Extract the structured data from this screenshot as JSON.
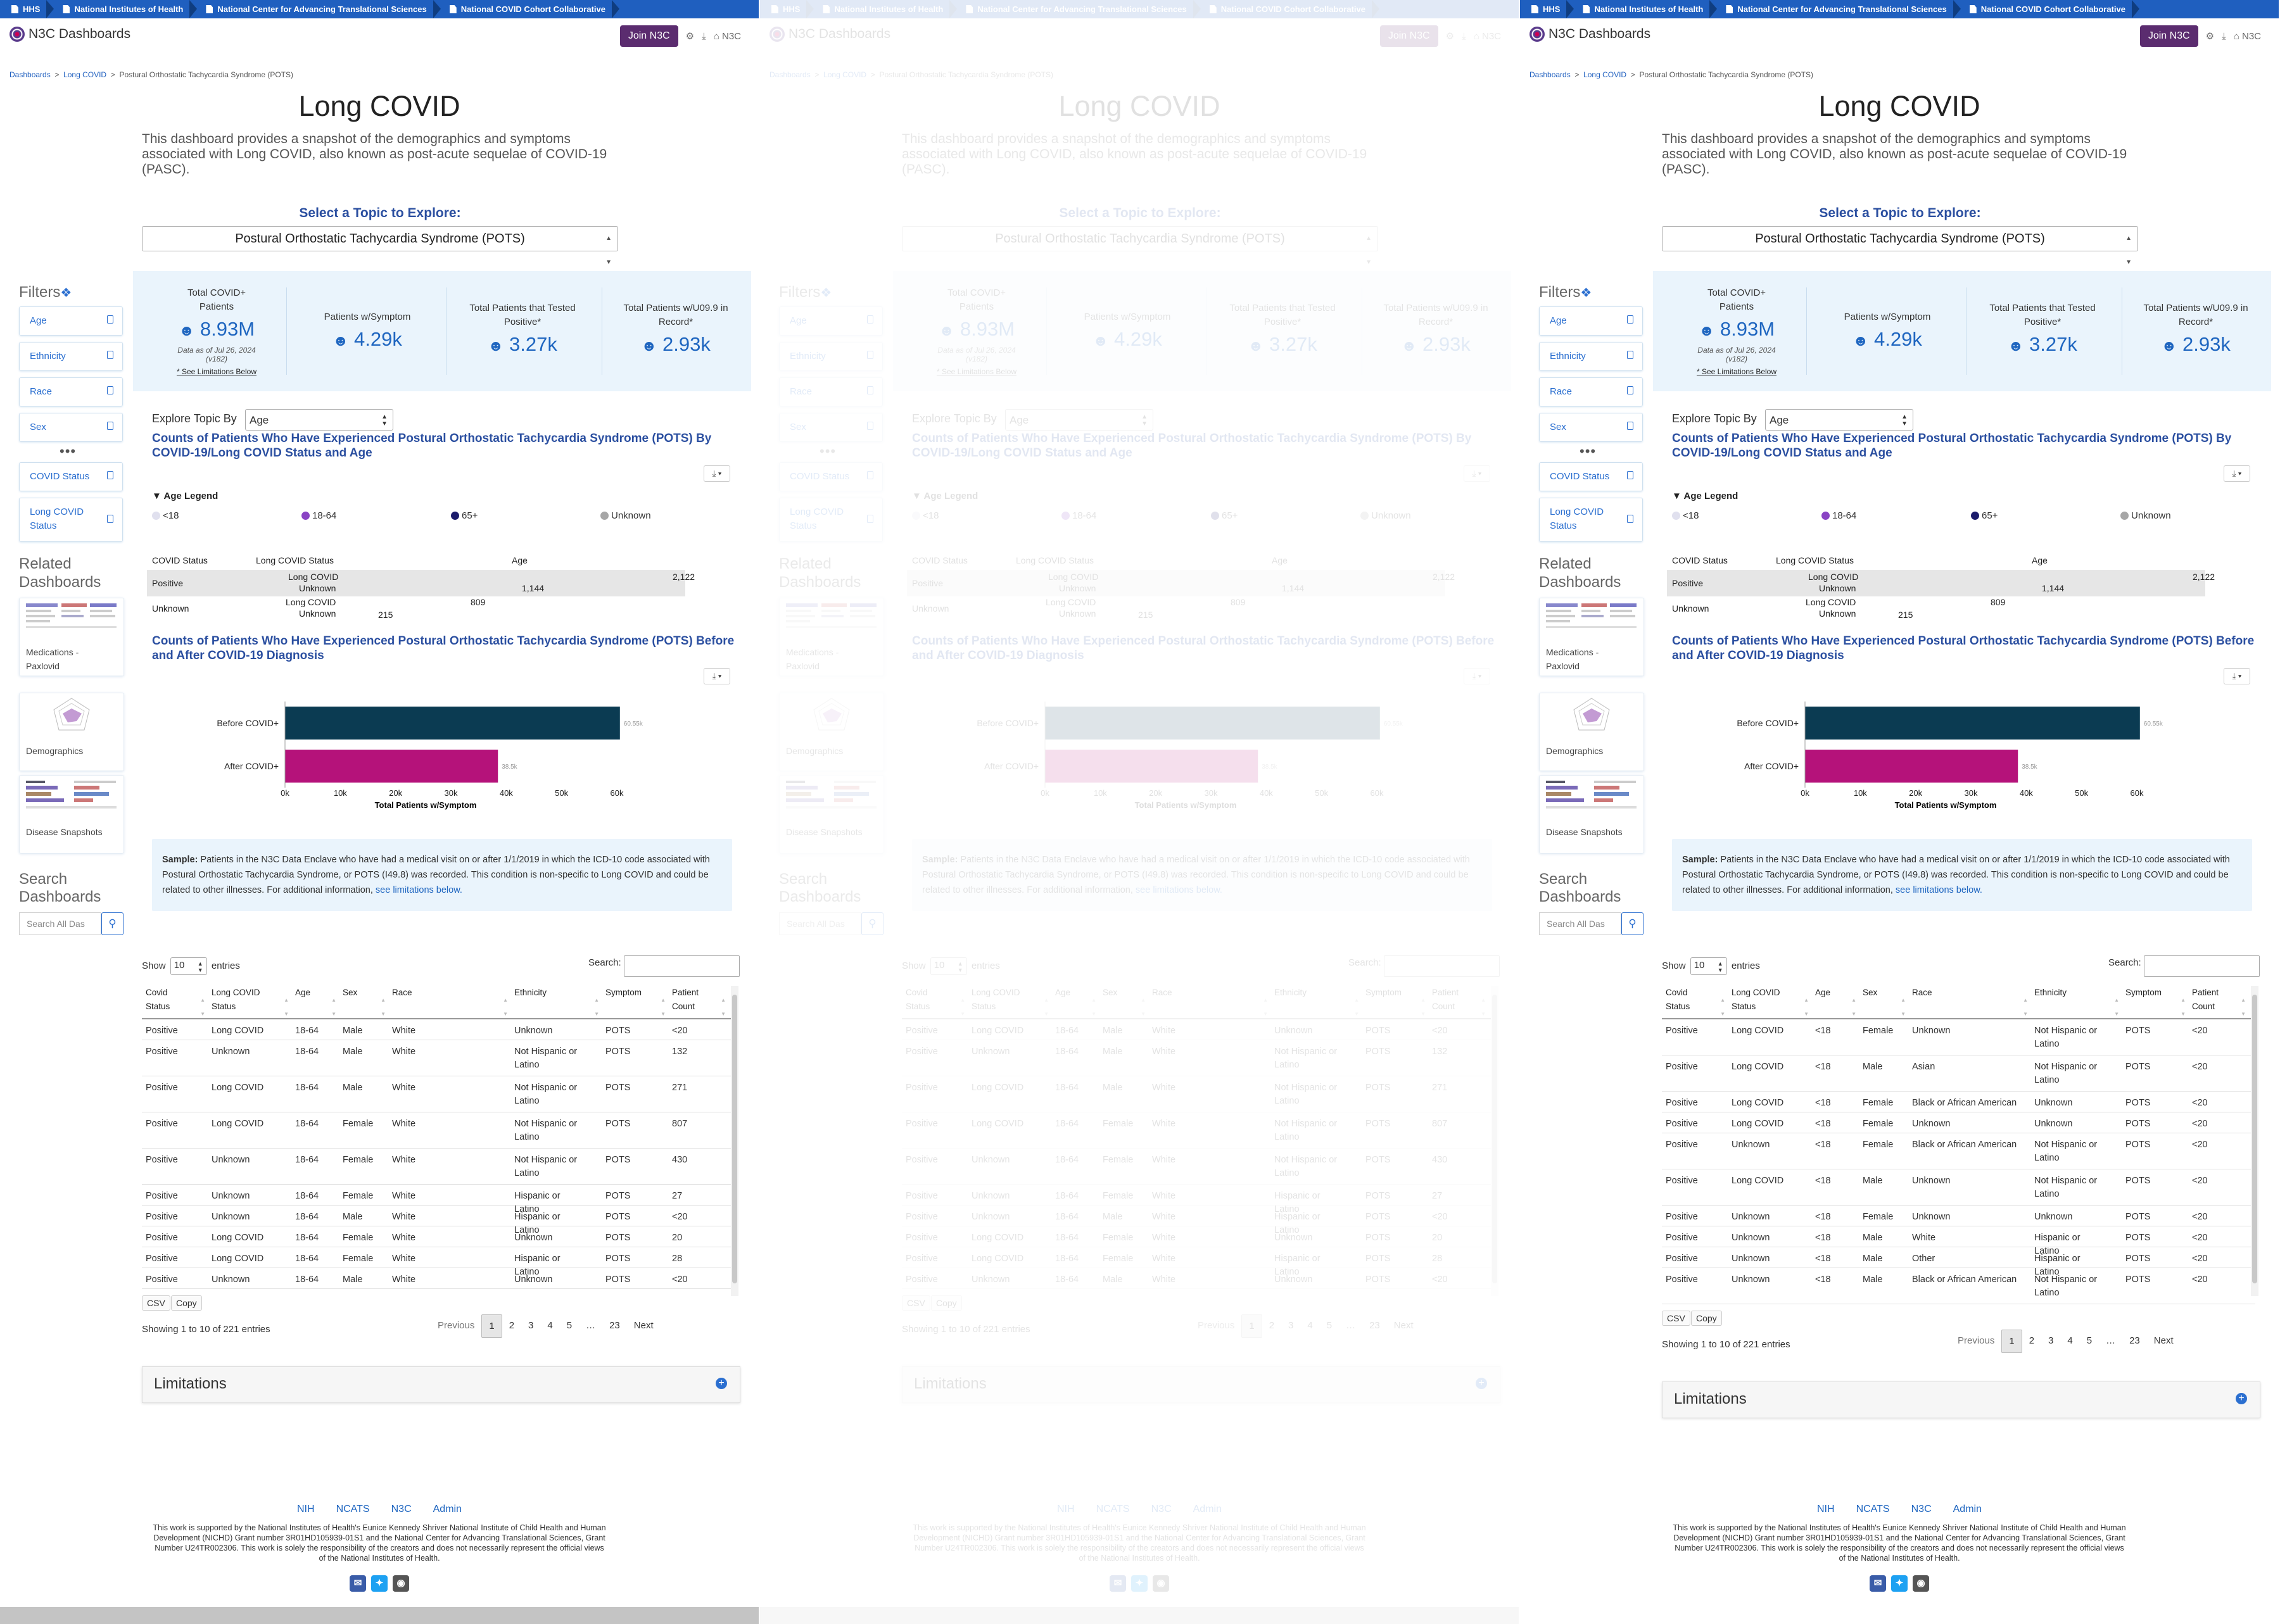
{
  "topbar": [
    "HHS",
    "National Institutes of Health",
    "National Center for Advancing Translational Sciences",
    "National COVID Cohort Collaborative"
  ],
  "nav": {
    "logo": "N3C Dashboards",
    "join": "Join N3C",
    "n3c": "N3C"
  },
  "breadcrumb": [
    "Dashboards",
    "Long COVID",
    "Postural Orthostatic Tachycardia Syndrome (POTS)"
  ],
  "title": "Long COVID",
  "desc": "This dashboard provides a snapshot of the demographics and symptoms associated with Long COVID, also known as post-acute sequelae of COVID-19 (PASC).",
  "topic": {
    "label": "Select a Topic to Explore:",
    "value": "Postural Orthostatic Tachycardia Syndrome (POTS)"
  },
  "filters": {
    "title": "Filters",
    "items": [
      "Age",
      "Ethnicity",
      "Race",
      "Sex",
      "COVID Status",
      "Long COVID Status"
    ],
    "more": "•••"
  },
  "related": {
    "title": "Related Dashboards",
    "items": [
      "Medications - Paxlovid",
      "Demographics",
      "Disease Snapshots"
    ]
  },
  "search": {
    "title": "Search Dashboards",
    "placeholder": "Search All Das"
  },
  "stats": {
    "total": {
      "label": "Total COVID+ Patients",
      "value": "8.93M",
      "note": "Data as of Jul 26, 2024 (v182)",
      "lim": "* See Limitations Below"
    },
    "symptom": {
      "label": "Patients w/Symptom",
      "value": "4.29k"
    },
    "tested": {
      "label": "Total Patients that Tested Positive*",
      "value": "3.27k"
    },
    "u099": {
      "label": "Total Patients w/U09.9 in Record*",
      "value": "2.93k"
    }
  },
  "explore": {
    "label": "Explore Topic By",
    "value": "Age"
  },
  "chart1": {
    "title": "Counts of Patients Who Have Experienced Postural Orthostatic Tachycardia Syndrome (POTS) By COVID-19/Long COVID Status and Age",
    "legend_title": "Age Legend",
    "legend": [
      {
        "name": "<18",
        "color": "#e0e0ee"
      },
      {
        "name": "18-64",
        "color": "#8a44c4"
      },
      {
        "name": "65+",
        "color": "#1c1c6c"
      },
      {
        "name": "Unknown",
        "color": "#a6a6a6"
      }
    ],
    "headers": [
      "COVID Status",
      "Long COVID Status",
      "Age"
    ]
  },
  "chart_data": [
    {
      "type": "bar",
      "title": "Counts of Patients Who Have Experienced Postural Orthostatic Tachycardia Syndrome (POTS) By COVID-19/Long COVID Status and Age",
      "rows": [
        {
          "covid": "Positive",
          "long_covid": "Long COVID",
          "total": 2122
        },
        {
          "covid": "Positive",
          "long_covid": "Unknown",
          "total": 1144
        },
        {
          "covid": "Unknown",
          "long_covid": "Long COVID",
          "total": 809
        },
        {
          "covid": "Unknown",
          "long_covid": "Unknown",
          "total": 215
        }
      ]
    },
    {
      "type": "bar",
      "title": "Counts of Patients Who Have Experienced Postural Orthostatic Tachycardia Syndrome (POTS) Before and After COVID-19 Diagnosis",
      "categories": [
        "Before COVID+",
        "After COVID+"
      ],
      "values": [
        60550,
        38500
      ],
      "data_labels": [
        "60.55k",
        "38.5k"
      ],
      "colors": [
        "#0b3b52",
        "#b5127a"
      ],
      "xlabel": "Total Patients w/Symptom",
      "xticks": [
        "0k",
        "10k",
        "20k",
        "30k",
        "40k",
        "50k",
        "60k"
      ],
      "xlim": [
        0,
        60000
      ]
    }
  ],
  "chart2": {
    "title": "Counts of Patients Who Have Experienced Postural Orthostatic Tachycardia Syndrome (POTS) Before and After COVID-19 Diagnosis"
  },
  "sample": {
    "bold": "Sample:",
    "text": " Patients in the N3C Data Enclave who have had a medical visit on or after 1/1/2019 in which the ICD-10 code associated with Postural Orthostatic Tachycardia Syndrome, or POTS (I49.8) was recorded. This condition is non-specific to Long COVID and could be related to other illnesses. For additional information, ",
    "link": "see limitations below."
  },
  "table": {
    "show": "Show",
    "entries": "entries",
    "pagesize": "10",
    "search": "Search:",
    "headers": [
      [
        "Covid",
        "Status"
      ],
      [
        "Long COVID",
        "Status"
      ],
      [
        "Age"
      ],
      [
        "Sex"
      ],
      [
        "Race"
      ],
      [
        "Ethnicity"
      ],
      [
        "Symptom"
      ],
      [
        "Patient",
        "Count"
      ]
    ],
    "rows_a": [
      [
        "Positive",
        "Long COVID",
        "18-64",
        "Male",
        "White",
        "Unknown",
        "POTS",
        "<20"
      ],
      [
        "Positive",
        "Unknown",
        "18-64",
        "Male",
        "White",
        "Not Hispanic or Latino",
        "POTS",
        "132"
      ],
      [
        "Positive",
        "Long COVID",
        "18-64",
        "Male",
        "White",
        "Not Hispanic or Latino",
        "POTS",
        "271"
      ],
      [
        "Positive",
        "Long COVID",
        "18-64",
        "Female",
        "White",
        "Not Hispanic or Latino",
        "POTS",
        "807"
      ],
      [
        "Positive",
        "Unknown",
        "18-64",
        "Female",
        "White",
        "Not Hispanic or Latino",
        "POTS",
        "430"
      ],
      [
        "Positive",
        "Unknown",
        "18-64",
        "Female",
        "White",
        "Hispanic or Latino",
        "POTS",
        "27"
      ],
      [
        "Positive",
        "Unknown",
        "18-64",
        "Male",
        "White",
        "Hispanic or Latino",
        "POTS",
        "<20"
      ],
      [
        "Positive",
        "Long COVID",
        "18-64",
        "Female",
        "White",
        "Unknown",
        "POTS",
        "20"
      ],
      [
        "Positive",
        "Long COVID",
        "18-64",
        "Female",
        "White",
        "Hispanic or Latino",
        "POTS",
        "28"
      ],
      [
        "Positive",
        "Unknown",
        "18-64",
        "Male",
        "White",
        "Unknown",
        "POTS",
        "<20"
      ]
    ],
    "rows_b": [
      [
        "Positive",
        "Long COVID",
        "<18",
        "Female",
        "Unknown",
        "Not Hispanic or Latino",
        "POTS",
        "<20"
      ],
      [
        "Positive",
        "Long COVID",
        "<18",
        "Male",
        "Asian",
        "Not Hispanic or Latino",
        "POTS",
        "<20"
      ],
      [
        "Positive",
        "Long COVID",
        "<18",
        "Female",
        "Black or African American",
        "Unknown",
        "POTS",
        "<20"
      ],
      [
        "Positive",
        "Long COVID",
        "<18",
        "Female",
        "Unknown",
        "Unknown",
        "POTS",
        "<20"
      ],
      [
        "Positive",
        "Unknown",
        "<18",
        "Female",
        "Black or African American",
        "Not Hispanic or Latino",
        "POTS",
        "<20"
      ],
      [
        "Positive",
        "Long COVID",
        "<18",
        "Male",
        "Unknown",
        "Not Hispanic or Latino",
        "POTS",
        "<20"
      ],
      [
        "Positive",
        "Unknown",
        "<18",
        "Female",
        "Unknown",
        "Unknown",
        "POTS",
        "<20"
      ],
      [
        "Positive",
        "Unknown",
        "<18",
        "Male",
        "White",
        "Hispanic or Latino",
        "POTS",
        "<20"
      ],
      [
        "Positive",
        "Unknown",
        "<18",
        "Male",
        "Other",
        "Hispanic or Latino",
        "POTS",
        "<20"
      ],
      [
        "Positive",
        "Unknown",
        "<18",
        "Male",
        "Black or African American",
        "Not Hispanic or Latino",
        "POTS",
        "<20"
      ]
    ],
    "csv": "CSV",
    "copy": "Copy",
    "showing": "Showing 1 to 10 of 221 entries",
    "pages": [
      "Previous",
      "1",
      "2",
      "3",
      "4",
      "5",
      "…",
      "23",
      "Next"
    ]
  },
  "limitations": "Limitations",
  "footer": {
    "links": [
      "NIH",
      "NCATS",
      "N3C",
      "Admin"
    ],
    "text": "This work is supported by the National Institutes of Health's Eunice Kennedy Shriver National Institute of Child Health and Human Development (NICHD) Grant number 3R01HD105939-01S1 and the National Center for Advancing Translational Sciences, Grant Number U24TR002306. This work is solely the responsibility of the creators and does not necessarily represent the official views of the National Institutes of Health."
  }
}
